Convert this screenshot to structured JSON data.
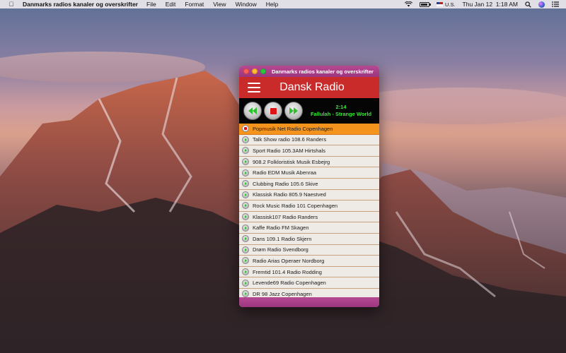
{
  "menubar": {
    "app_name": "Danmarks radios kanaler og overskrifter",
    "menus": [
      "File",
      "Edit",
      "Format",
      "View",
      "Window",
      "Help"
    ],
    "input_source": "U.S.",
    "clock": "Thu Jan 12  1:18 AM",
    "icons": [
      "wifi-icon",
      "battery-icon",
      "flag-icon",
      "search-icon",
      "siri-icon",
      "notification-center-icon"
    ]
  },
  "window": {
    "title": "Danmarks radios kanaler og overskrifter",
    "header_title": "Dansk Radio",
    "player": {
      "time": "2:14",
      "track": "Fallulah - Strange World"
    },
    "stations": [
      {
        "label": "Popmusik Net Radio Copenhagen",
        "active": true
      },
      {
        "label": "Talk Show radio 108.6 Randers"
      },
      {
        "label": "Sport Radio 105.3AM Hirtshals"
      },
      {
        "label": "908.2 Folkloristisk Musik Esbejrg"
      },
      {
        "label": "Radio EDM Musik Abenraa"
      },
      {
        "label": "Clubbing Radio 105.6 Skive"
      },
      {
        "label": "Klassisk Radio 805.9 Naestved"
      },
      {
        "label": "Rock Music Radio 101 Copenhagen"
      },
      {
        "label": "Klassisk107 Radio Randers"
      },
      {
        "label": "Kaffe Radio FM Skagen"
      },
      {
        "label": "Dans 109.1 Radio Skjern"
      },
      {
        "label": "Drøm Radio Svendborg"
      },
      {
        "label": "Radio Arias Operaer Nordborg"
      },
      {
        "label": "Fremtid 101.4 Radio Rodding"
      },
      {
        "label": "Levende69 Radio Copenhagen"
      },
      {
        "label": "DR 98 Jazz Copenhagen"
      }
    ]
  },
  "colors": {
    "titlebar": "#a63c87",
    "header": "#c92a2a",
    "active_row": "#f5941d",
    "now_playing_text": "#39e639"
  }
}
